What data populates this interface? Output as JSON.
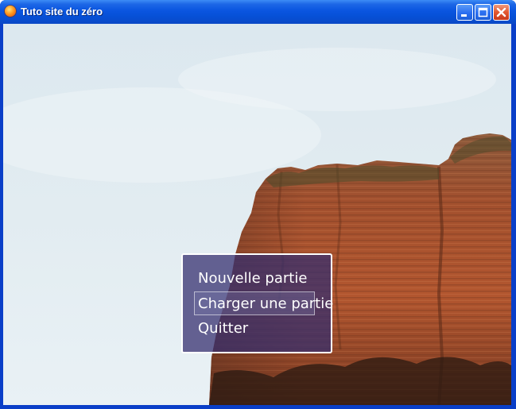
{
  "window": {
    "title": "Tuto site du zéro",
    "app_icon": "sdz-flame-icon",
    "controls": {
      "minimize_icon": "minimize-icon",
      "maximize_icon": "maximize-icon",
      "close_icon": "close-icon"
    }
  },
  "background": {
    "subject": "sky-and-red-rock-cliff",
    "sky_color": "#e3edf2",
    "rock_color": "#9a4a2a"
  },
  "menu": {
    "items": [
      {
        "label": "Nouvelle partie",
        "selected": false
      },
      {
        "label": "Charger une partie",
        "selected": true
      },
      {
        "label": "Quitter",
        "selected": false
      }
    ],
    "panel_color": "#342e6e",
    "border_color": "#ffffff"
  }
}
